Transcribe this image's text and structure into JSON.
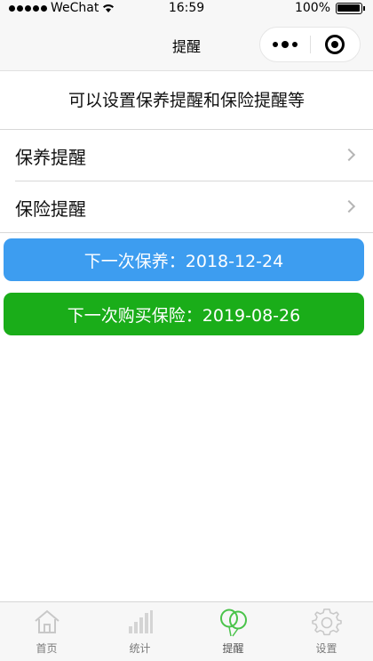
{
  "status_bar": {
    "carrier": "WeChat",
    "time": "16:59",
    "battery": "100%",
    "battery_level": 1.0
  },
  "nav": {
    "title": "提醒",
    "more_icon": "more-dots-icon",
    "close_icon": "record-close-icon"
  },
  "description": "可以设置保养提醒和保险提醒等",
  "list": {
    "items": [
      {
        "label": "保养提醒",
        "icon": "chevron-right-icon"
      },
      {
        "label": "保险提醒",
        "icon": "chevron-right-icon"
      }
    ]
  },
  "reminders": {
    "maintenance": "下一次保养：2018-12-24",
    "insurance": "下一次购买保险：2019-08-26",
    "maintenance_color": "#3d9df0",
    "insurance_color": "#1aad19"
  },
  "tabbar": {
    "tabs": [
      {
        "label": "首页",
        "icon": "home-icon"
      },
      {
        "label": "统计",
        "icon": "bar-chart-icon"
      },
      {
        "label": "提醒",
        "icon": "balloon-icon",
        "active": true
      },
      {
        "label": "设置",
        "icon": "gear-icon"
      }
    ],
    "active_color": "#4ac34a",
    "inactive_color": "#c8c8c8"
  }
}
